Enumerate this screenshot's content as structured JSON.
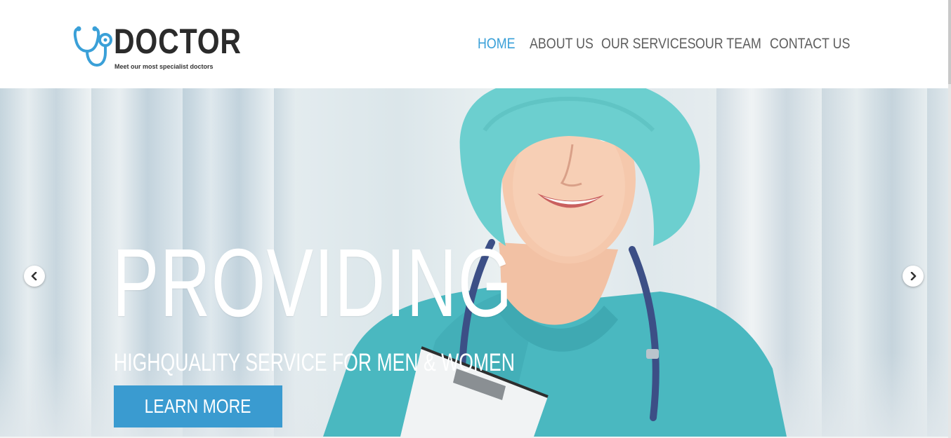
{
  "brand": {
    "name": "DOCTOR",
    "tagline": "Meet our most specialist doctors",
    "icon": "stethoscope-icon",
    "accent_color": "#3aa0d8"
  },
  "nav": {
    "items": [
      {
        "label": "HOME",
        "active": true
      },
      {
        "label": "ABOUT US",
        "active": false
      },
      {
        "label": "OUR SERVICES",
        "active": false
      },
      {
        "label": "OUR TEAM",
        "active": false
      },
      {
        "label": "CONTACT US",
        "active": false
      }
    ]
  },
  "slider": {
    "title": "PROVIDING",
    "subtitle": "HIGHQUALITY SERVICE FOR MEN & WOMEN",
    "button_label": "LEARN MORE",
    "button_color": "#3a9bd0",
    "prev_icon": "chevron-left-icon",
    "next_icon": "chevron-right-icon"
  }
}
